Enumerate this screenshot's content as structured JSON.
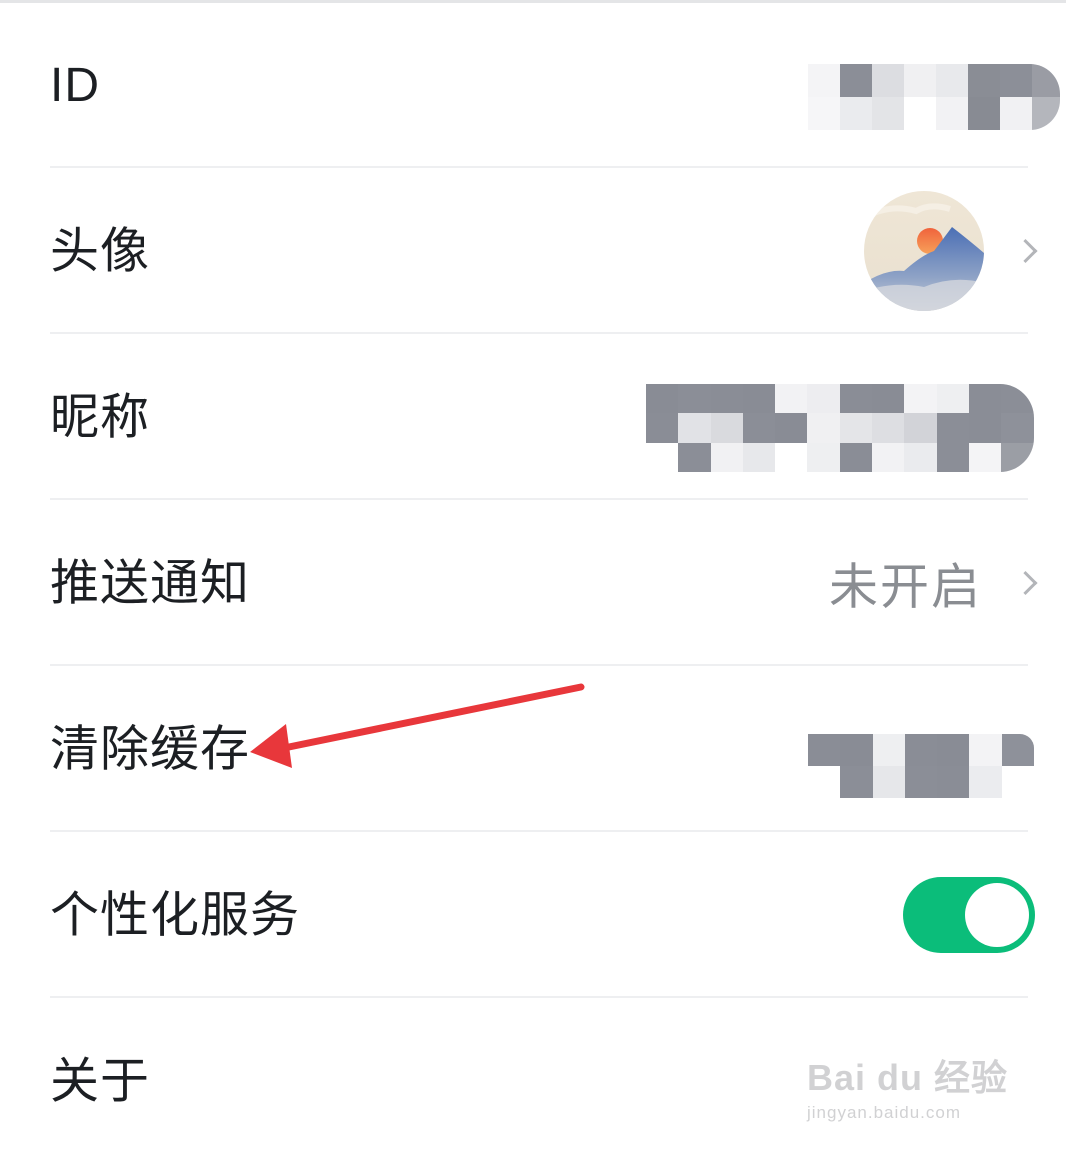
{
  "settings": {
    "id_label": "ID",
    "avatar_label": "头像",
    "nickname_label": "昵称",
    "push_label": "推送通知",
    "push_value": "未开启",
    "cache_label": "清除缓存",
    "personalized_label": "个性化服务",
    "personalized_enabled": true,
    "about_label": "关于"
  },
  "redactions": {
    "id_value": "pixelated",
    "nickname_value": "pixelated",
    "cache_value": "pixelated"
  },
  "icons": {
    "chevron": "chevron-right-icon",
    "avatar": "mountain-sunset-avatar"
  },
  "colors": {
    "toggle_on": "#0bbd7a",
    "annotation_arrow": "#e8373b",
    "divider": "#eeeff1",
    "secondary_text": "#8a8d92"
  },
  "watermark": {
    "brand": "Bai du 经验",
    "site": "jingyan.baidu.com"
  }
}
